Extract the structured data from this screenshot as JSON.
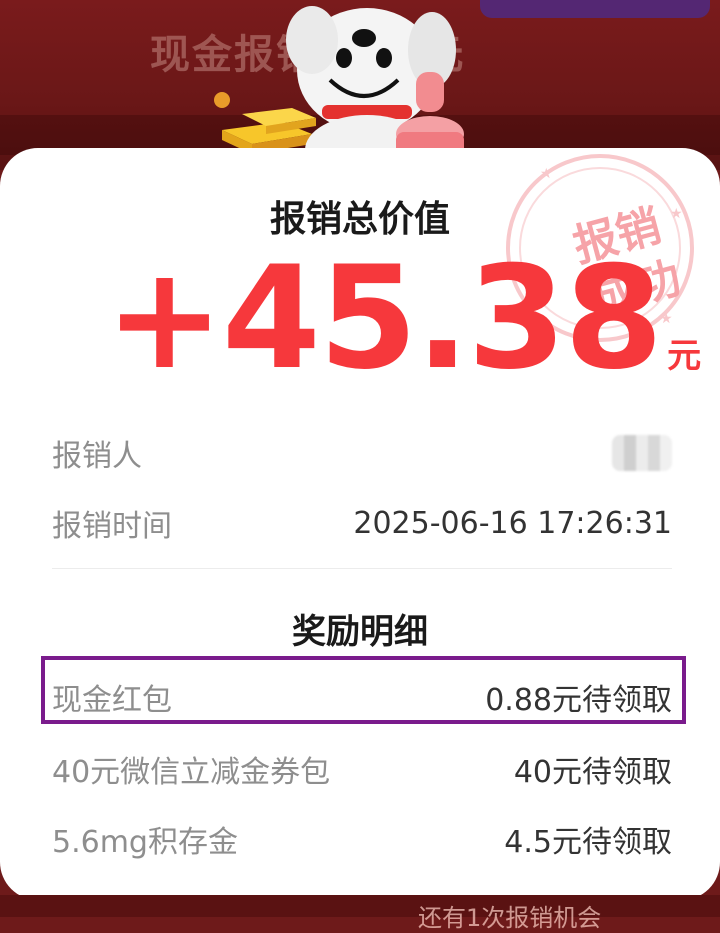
{
  "background": {
    "banner_text": "现金报销 180元",
    "bottom_text": "还有1次报销机会"
  },
  "stamp": {
    "line1": "报销",
    "line2": "成功",
    "color": "#f6a3a8"
  },
  "card": {
    "title": "报销总价值",
    "amount": "+45.38",
    "unit": "元",
    "accent_color": "#f6383c"
  },
  "info": {
    "reimburser_label": "报销人",
    "time_label": "报销时间",
    "time_value": "2025-06-16 17:26:31"
  },
  "rewards": {
    "title": "奖励明细",
    "items": [
      {
        "label": "现金红包",
        "value": "0.88元待领取"
      },
      {
        "label": "40元微信立减金券包",
        "value": "40元待领取"
      },
      {
        "label": "5.6mg积存金",
        "value": "4.5元待领取"
      }
    ]
  }
}
